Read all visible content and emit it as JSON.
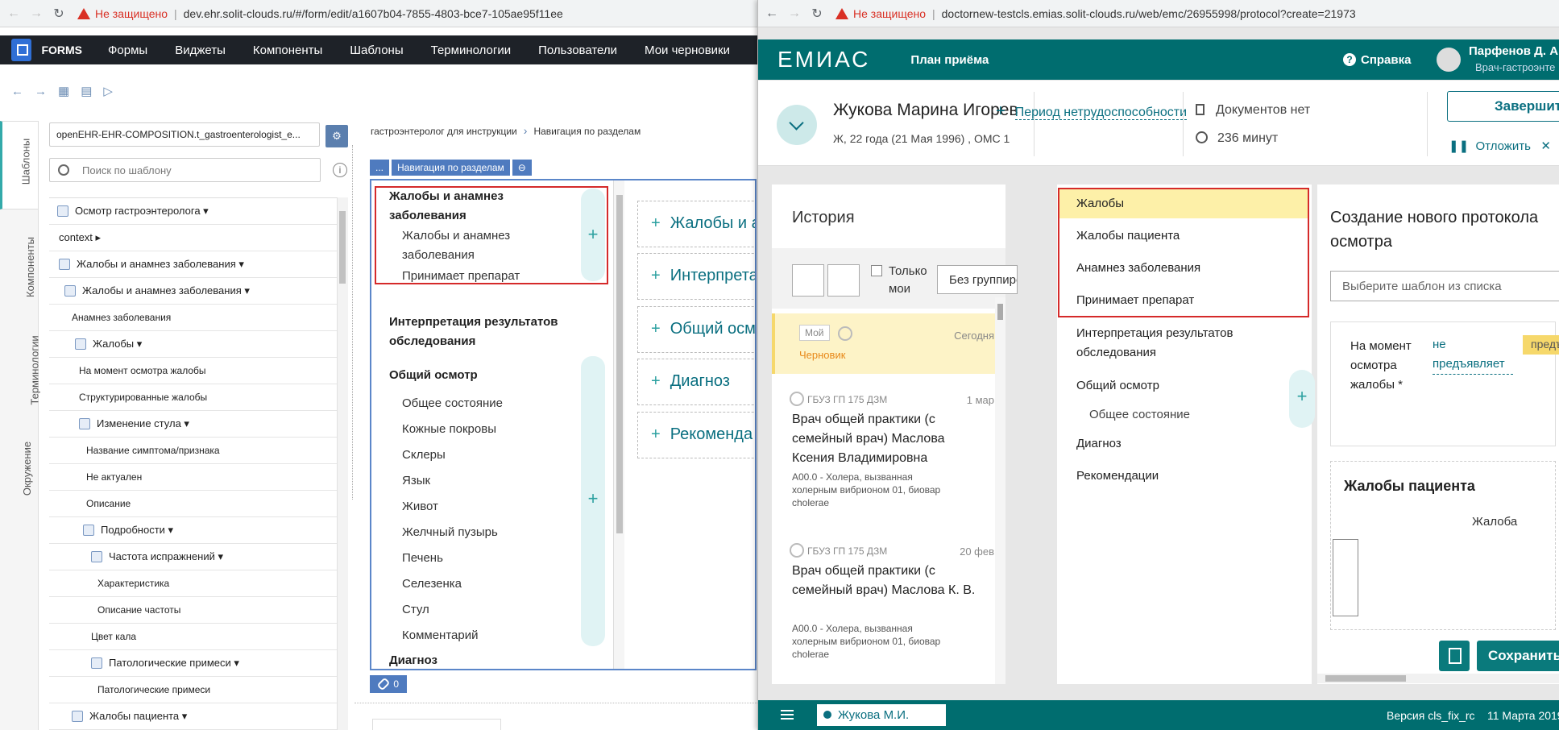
{
  "left_browser": {
    "insecure_label": "Не защищено",
    "url": "dev.ehr.solit-clouds.ru/#/form/edit/a1607b04-7855-4803-bce7-105ae95f11ee"
  },
  "left_app": {
    "brand": "FORMS",
    "menu": [
      "Формы",
      "Виджеты",
      "Компоненты",
      "Шаблоны",
      "Терминологии",
      "Пользователи",
      "Мои черновики"
    ],
    "vtabs": [
      "Шаблоны",
      "Компоненты",
      "Терминологии",
      "Окружение"
    ],
    "template_select": "openEHR-EHR-COMPOSITION.t_gastroenterologist_e...",
    "search_placeholder": "Поиск по шаблону",
    "tree": [
      "Осмотр гастроэнтеролога",
      "context",
      "Жалобы и анамнез заболевания",
      "Жалобы и анамнез заболевания",
      "Анамнез заболевания",
      "Жалобы",
      "На момент осмотра жалобы",
      "Структурированные жалобы",
      "Изменение стула",
      "Название симптома/признака",
      "Не актуален",
      "Описание",
      "Подробности",
      "Частота испражнений",
      "Характеристика",
      "Описание частоты",
      "Цвет кала",
      "Патологические примеси",
      "Патологические примеси",
      "Жалобы пациента"
    ],
    "breadcrumb": [
      "гастроэнтеролог для инструкции",
      "Навигация по разделам"
    ],
    "bluebar": [
      "...",
      "Навигация по разделам",
      "⊖"
    ],
    "nav_items": {
      "s1": "Жалобы и анамнез",
      "s1b": "заболевания",
      "s1a": "Жалобы и анамнез",
      "s1a2": "заболевания",
      "s1c": "Принимает препарат",
      "s2": "Интерпретация результатов",
      "s2b": "обследования",
      "s3": "Общий осмотр",
      "s3items": [
        "Общее состояние",
        "Кожные покровы",
        "Склеры",
        "Язык",
        "Живот",
        "Желчный пузырь",
        "Печень",
        "Селезенка",
        "Стул",
        "Комментарий"
      ],
      "s4": "Диагноз"
    },
    "sections": [
      "Жалобы и а",
      "Интерпрета",
      "Общий осм",
      "Диагноз",
      "Рекоменда"
    ],
    "link_count": "0",
    "plus": "+"
  },
  "right_browser": {
    "insecure_label": "Не защищено",
    "url": "doctornew-testcls.emias.solit-clouds.ru/web/emc/26955998/protocol?create=21973"
  },
  "right_app": {
    "logo": "ЕМИАС",
    "plan": "План приёма",
    "help": "Справка",
    "user_name": "Парфенов Д. А",
    "user_role": "Врач-гастроэнте",
    "patient_name": "Жукова Марина Игорев",
    "patient_info": "Ж, 22 года (21 Мая 1996) , ОМС 1",
    "sick_leave": "Период нетрудоспособности",
    "docs": "Документов нет",
    "minutes": "236 минут",
    "finish": "Завершит",
    "postpone": "Отложить",
    "history_title": "История",
    "only_mine": [
      "Только",
      "мои"
    ],
    "grouping": "Без группировки",
    "hist_cards": [
      {
        "mine": "Мой",
        "status": "Черновик",
        "date": "Сегодня"
      },
      {
        "org": "ГБУЗ ГП 175 ДЗМ",
        "date": "1 мар",
        "doctor": "Врач общей практики (с семейный врач) Маслова Ксения Владимировна",
        "diag": "А00.0 - Холера, вызванная холерным вибрионом 01, биовар cholerae"
      },
      {
        "org": "ГБУЗ ГП 175 ДЗМ",
        "date": "20 фев",
        "doctor": "Врач общей практики (с семейный врач) Маслова К. В.",
        "diag": "А00.0 - Холера, вызванная холерным вибрионом 01, биовар cholerae"
      }
    ],
    "nav": [
      "Жалобы",
      "Жалобы пациента",
      "Анамнез заболевания",
      "Принимает препарат",
      "Интерпретация результатов",
      "обследования",
      "Общий осмотр",
      "Общее состояние",
      "Диагноз",
      "Рекомендации"
    ],
    "proto_title": "Создание нового протокола осмотра",
    "template_placeholder": "Выберите шаблон из списка",
    "card1_label": "На момент осмотра жалобы *",
    "card1_value": "не предъявляет",
    "card1_tag": "предъ",
    "card2_title": "Жалобы пациента",
    "card2_sub": "Жалоба",
    "save": "Сохранить",
    "footer_user": "Жукова М.И.",
    "version": "Версия cls_fix_rc",
    "date": "11 Марта 2019"
  },
  "colors": {
    "emias_teal": "#006d6f",
    "highlight_yellow": "#fdf0a8",
    "red_box": "#d52a2a",
    "forms_blue": "#4f7bbf"
  }
}
